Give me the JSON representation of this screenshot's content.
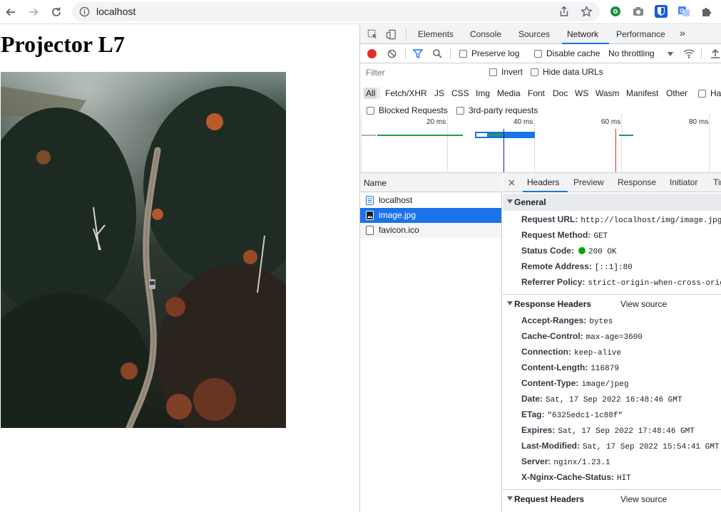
{
  "browser": {
    "url": "localhost",
    "extensions": [
      "puzzle-green-icon",
      "camera-icon",
      "bitwarden-icon",
      "translate-icon",
      "puzzle-icon"
    ]
  },
  "page": {
    "title": "Projector L7",
    "image_alt": "Aerial view of a dirt road through an autumn forest"
  },
  "devtools": {
    "tabs": [
      "Elements",
      "Console",
      "Sources",
      "Network",
      "Performance"
    ],
    "active_tab": "Network",
    "more_tabs": "»",
    "toolbar": {
      "preserve_log": "Preserve log",
      "disable_cache": "Disable cache",
      "throttling": "No throttling"
    },
    "filter": {
      "placeholder": "Filter",
      "invert": "Invert",
      "hide_data_urls": "Hide data URLs",
      "types": [
        "All",
        "Fetch/XHR",
        "JS",
        "CSS",
        "Img",
        "Media",
        "Font",
        "Doc",
        "WS",
        "Wasm",
        "Manifest",
        "Other"
      ],
      "has_blocked_cookies": "Ha",
      "blocked_requests": "Blocked Requests",
      "third_party": "3rd-party requests"
    },
    "overview": {
      "ticks": [
        "20 ms",
        "40 ms",
        "60 ms",
        "80 ms"
      ]
    },
    "requests": {
      "header": "Name",
      "items": [
        {
          "name": "localhost",
          "type": "doc"
        },
        {
          "name": "image.jpg",
          "type": "img",
          "selected": true
        },
        {
          "name": "favicon.ico",
          "type": "other"
        }
      ]
    },
    "detail_tabs": [
      "Headers",
      "Preview",
      "Response",
      "Initiator",
      "Tir"
    ],
    "general": {
      "title": "General",
      "rows": [
        {
          "key": "Request URL:",
          "value": "http://localhost/img/image.jpg"
        },
        {
          "key": "Request Method:",
          "value": "GET"
        },
        {
          "key": "Status Code:",
          "value": "200 OK"
        },
        {
          "key": "Remote Address:",
          "value": "[::1]:80"
        },
        {
          "key": "Referrer Policy:",
          "value": "strict-origin-when-cross-origin"
        }
      ]
    },
    "response_headers": {
      "title": "Response Headers",
      "view_source": "View source",
      "rows": [
        {
          "key": "Accept-Ranges:",
          "value": "bytes"
        },
        {
          "key": "Cache-Control:",
          "value": "max-age=3600"
        },
        {
          "key": "Connection:",
          "value": "keep-alive"
        },
        {
          "key": "Content-Length:",
          "value": "116879"
        },
        {
          "key": "Content-Type:",
          "value": "image/jpeg"
        },
        {
          "key": "Date:",
          "value": "Sat, 17 Sep 2022 16:48:46 GMT"
        },
        {
          "key": "ETag:",
          "value": "\"6325edc1-1c88f\""
        },
        {
          "key": "Expires:",
          "value": "Sat, 17 Sep 2022 17:48:46 GMT"
        },
        {
          "key": "Last-Modified:",
          "value": "Sat, 17 Sep 2022 15:54:41 GMT"
        },
        {
          "key": "Server:",
          "value": "nginx/1.23.1"
        },
        {
          "key": "X-Nginx-Cache-Status:",
          "value": "HIT"
        }
      ]
    },
    "request_headers": {
      "title": "Request Headers",
      "view_source": "View source"
    },
    "colors": {
      "accent": "#1a73e8",
      "selected_row": "#1a73e8",
      "record": "#e52d27",
      "status_ok": "#0a0"
    }
  }
}
